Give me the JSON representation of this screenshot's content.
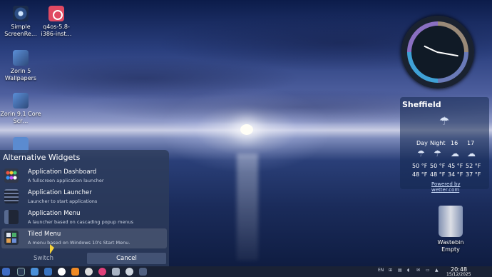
{
  "desktop_icons": [
    {
      "label": "Simple ScreenRe…"
    },
    {
      "label": "q4os-5.8-i386-inst…"
    },
    {
      "label": "Zorin 5 Wallpapers"
    },
    {
      "label": "Zorin 9.1 Core Scr…"
    }
  ],
  "weather": {
    "city": "Sheffield",
    "headers": [
      "Day",
      "Night",
      "16",
      "17"
    ],
    "row1": [
      "50 °F",
      "50 °F",
      "45 °F",
      "52 °F"
    ],
    "row2": [
      "48 °F",
      "48 °F",
      "34 °F",
      "37 °F"
    ],
    "credit": "Powered by wetter.com",
    "icon": "rain-cloud-icon"
  },
  "panel": {
    "title": "Alternative Widgets",
    "items": [
      {
        "name": "Application Dashboard",
        "desc": "A fullscreen application launcher"
      },
      {
        "name": "Application Launcher",
        "desc": "Launcher to start applications"
      },
      {
        "name": "Application Menu",
        "desc": "A launcher based on cascading popup menus"
      },
      {
        "name": "Tiled Menu",
        "desc": "A menu based on Windows 10's Start Menu."
      }
    ],
    "switch_label": "Switch",
    "cancel_label": "Cancel"
  },
  "wastebin": {
    "label": "Wastebin",
    "status": "Empty"
  },
  "taskbar": {
    "lang": "EN",
    "time": "20:48",
    "date": "15/12/2025"
  },
  "colors": {
    "panel_bg": "#2d3c5a",
    "taskbar_bg": "#1a2235",
    "accent": "#3fa1d6"
  }
}
